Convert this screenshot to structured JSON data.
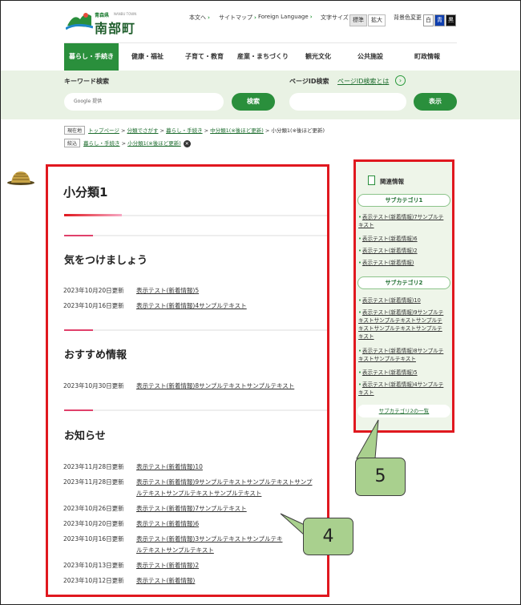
{
  "header": {
    "logo_small": "青森県",
    "logo_en": "NANBU TOWN",
    "logo_name": "南部町",
    "util_links": [
      {
        "label": "本文へ"
      },
      {
        "label": "サイトマップ"
      },
      {
        "label": "Foreign Language"
      }
    ],
    "font_size_label": "文字サイズ",
    "font_size_options": [
      "標準",
      "拡大"
    ],
    "bg_label": "背景色変更",
    "bg_options": [
      {
        "label": "白",
        "bg": "#ffffff",
        "fg": "#333333"
      },
      {
        "label": "青",
        "bg": "#1040b0",
        "fg": "#ffffff"
      },
      {
        "label": "黒",
        "bg": "#111111",
        "fg": "#ffffff"
      }
    ]
  },
  "nav": {
    "items": [
      {
        "label": "暮らし・手続き",
        "active": true
      },
      {
        "label": "健康・福祉"
      },
      {
        "label": "子育て・教育"
      },
      {
        "label": "産業・まちづくり"
      },
      {
        "label": "観光文化"
      },
      {
        "label": "公共施設"
      },
      {
        "label": "町政情報"
      }
    ]
  },
  "search": {
    "keyword_title": "キーワード検索",
    "keyword_placeholder": "Google 提供",
    "keyword_button": "検索",
    "pageid_title": "ページID検索",
    "pageid_link": "ページID検索とは",
    "pageid_placeholder": "",
    "pageid_button": "表示"
  },
  "breadcrumb": {
    "here_tag": "現在地",
    "path": [
      "トップページ",
      "分類でさがす",
      "暮らし・手続き",
      "中分類1(※後ほど更新)"
    ],
    "current": "小分類1(※後ほど更新)",
    "filter_tag": "絞込",
    "filters": [
      "暮らし・手続き",
      "小分類1(※後ほど更新)"
    ]
  },
  "main": {
    "title": "小分類1",
    "sections": [
      {
        "heading": "気をつけましょう",
        "items": [
          {
            "date": "2023年10月20日更新",
            "title": "表示テスト(新着情報)5"
          },
          {
            "date": "2023年10月16日更新",
            "title": "表示テスト(新着情報)4サンプルテキスト"
          }
        ]
      },
      {
        "heading": "おすすめ情報",
        "items": [
          {
            "date": "2023年10月30日更新",
            "title": "表示テスト(新着情報)8サンプルテキストサンプルテキスト"
          }
        ]
      },
      {
        "heading": "お知らせ",
        "items": [
          {
            "date": "2023年11月28日更新",
            "title": "表示テスト(新着情報)10"
          },
          {
            "date": "2023年11月28日更新",
            "title": "表示テスト(新着情報)9サンプルテキストサンプルテキストサンプ",
            "title2": "ルテキストサンプルテキストサンプルテキスト"
          },
          {
            "date": "2023年10月26日更新",
            "title": "表示テスト(新着情報)7サンプルテキスト"
          },
          {
            "date": "2023年10月20日更新",
            "title": "表示テスト(新着情報)6"
          },
          {
            "date": "2023年10月16日更新",
            "title": "表示テスト(新着情報)3サンプルテキストサンプルテキ",
            "title2": "ルテキストサンプルテキスト"
          },
          {
            "date": "2023年10月13日更新",
            "title": "表示テスト(新着情報)2"
          },
          {
            "date": "2023年10月12日更新",
            "title": "表示テスト(新着情報)"
          }
        ]
      }
    ]
  },
  "sidebar": {
    "title": "関連情報",
    "categories": [
      {
        "label": "サブカテゴリ1",
        "items": [
          [
            "表示テスト(新着情報)7サンプルテ",
            "キスト"
          ],
          [
            "表示テスト(新着情報)6"
          ],
          [
            "表示テスト(新着情報)2"
          ],
          [
            "表示テスト(新着情報)"
          ]
        ]
      },
      {
        "label": "サブカテゴリ2",
        "items": [
          [
            "表示テスト(新着情報)10"
          ],
          [
            "表示テスト(新着情報)9サンプルテ",
            "キストサンプルテキストサンプルテ",
            "キストサンプルテキストサンプルテ",
            "キスト"
          ],
          [
            "表示テスト(新着情報)8サンプルテ",
            "キストサンプルテキスト"
          ],
          [
            "表示テスト(新着情報)5"
          ],
          [
            "表示テスト(新着情報)4サンプルテ",
            "キスト"
          ]
        ]
      }
    ],
    "more_link": "サブカテゴリ2の一覧"
  },
  "annotations": {
    "callout_4": "4",
    "callout_5": "5",
    "highlight_color": "#e0181f",
    "callout_color": "#a9d08e"
  }
}
